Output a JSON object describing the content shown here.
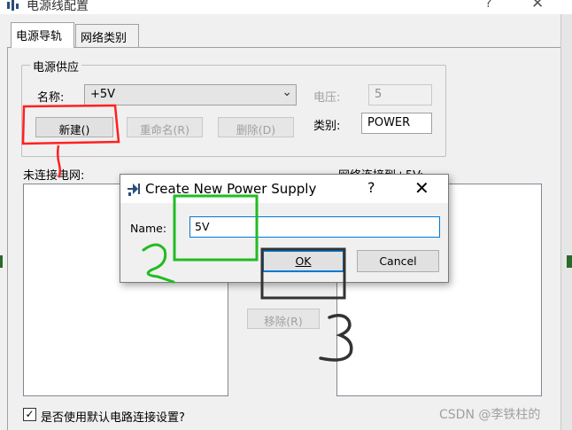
{
  "window": {
    "title": "电源线配置",
    "help": "?",
    "close": "✕"
  },
  "tabs": [
    {
      "label": "电源导轨",
      "selected": true
    },
    {
      "label": "网络类别",
      "selected": false
    }
  ],
  "power_group": {
    "title": "电源供应",
    "name_label": "名称:",
    "name_value": "+5V",
    "voltage_label": "电压:",
    "voltage_value": "5",
    "class_label": "类别:",
    "class_value": "POWER",
    "new_button": "新建()",
    "rename_button": "重命名(R)",
    "delete_button": "删除(D)"
  },
  "lists": {
    "unconnected_label": "未连接电网:",
    "connected_label": "网络连接到+5V:",
    "remove_button": "移除(R)"
  },
  "checkbox": {
    "label": "是否使用默认电路连接设置?",
    "checked": true
  },
  "dialog": {
    "title": "Create New Power Supply",
    "help": "?",
    "close": "✕",
    "name_label": "Name:",
    "name_value": "5V",
    "ok_button": "OK",
    "cancel_button": "Cancel"
  },
  "annotations": {
    "step2": "2",
    "step3": "3",
    "colors": {
      "red": "#ff2020",
      "green": "#22bb22",
      "gray": "#333333"
    }
  },
  "watermark": "CSDN @李铁柱的"
}
